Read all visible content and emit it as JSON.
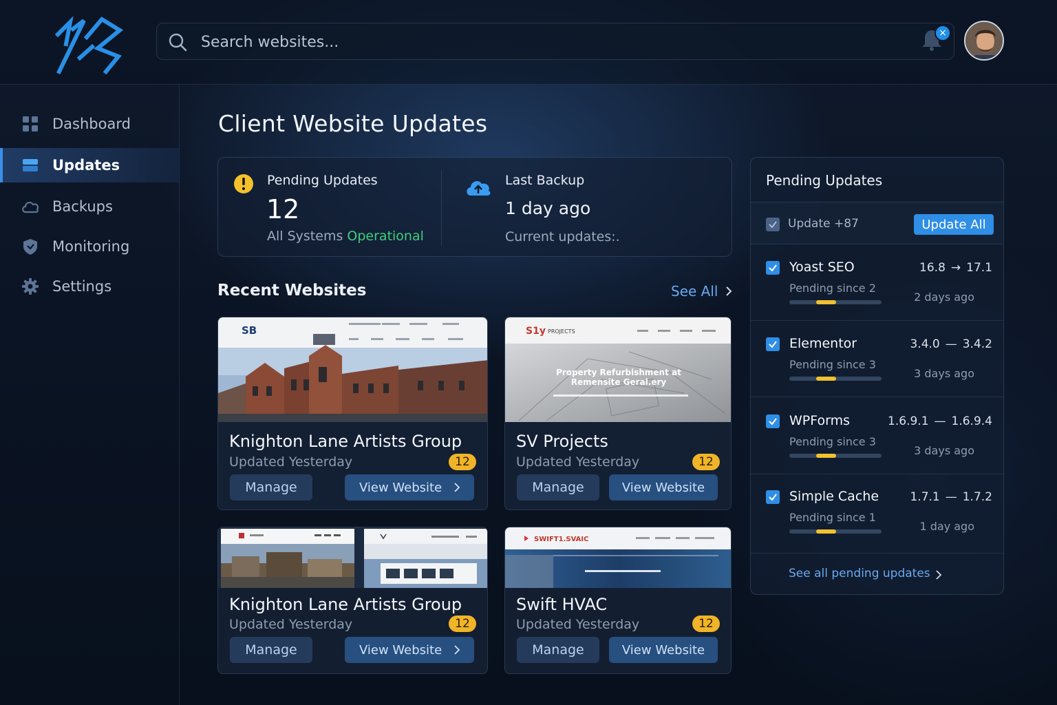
{
  "search": {
    "placeholder": "Search websites..."
  },
  "notifications": {
    "badge": "×"
  },
  "sidebar": {
    "items": [
      {
        "label": "Dashboard",
        "icon": "grid-icon",
        "active": false
      },
      {
        "label": "Updates",
        "icon": "layers-icon",
        "active": true
      },
      {
        "label": "Backups",
        "icon": "cloud-icon",
        "active": false
      },
      {
        "label": "Monitoring",
        "icon": "shield-icon",
        "active": false
      },
      {
        "label": "Settings",
        "icon": "gear-icon",
        "active": false
      }
    ]
  },
  "main": {
    "title": "Client Website Updates",
    "stats": {
      "pending_label": "Pending Updates",
      "pending_count": "12",
      "status_prefix": "All Systems",
      "status_value": "Operational",
      "backup_label": "Last Backup",
      "backup_value": "1 day ago",
      "backup_sub": "Current updates:."
    },
    "recent": {
      "title": "Recent Websites",
      "see_all": "See All",
      "sites": [
        {
          "name": "Knighton Lane Artists Group",
          "updated": "Updated Yesterday",
          "count": "12",
          "manage": "Manage",
          "view": "View Website",
          "thumb_brand": "SB"
        },
        {
          "name": "SV Projects",
          "updated": "Updated Yesterday",
          "count": "12",
          "manage": "Manage",
          "view": "View Website",
          "thumb_brand": "S1y",
          "thumb_nav": "PROJECTS",
          "thumb_headline_1": "Property Refurbishment at",
          "thumb_headline_2": "Remensite Geral.ery"
        },
        {
          "name": "Knighton Lane Artists Group",
          "updated": "Updated Yesterday",
          "count": "12",
          "manage": "Manage",
          "view": "View Website"
        },
        {
          "name": "Swift HVAC",
          "updated": "Updated Yesterday",
          "count": "12",
          "manage": "Manage",
          "view": "View Website",
          "thumb_brand": "SWIFT1.SVAIC"
        }
      ]
    }
  },
  "panel": {
    "title": "Pending Updates",
    "select_label": "Update +87",
    "update_all": "Update All",
    "updates": [
      {
        "name": "Yoast SEO",
        "since": "Pending since 2",
        "from": "16.8",
        "arrow": "→",
        "to": "17.1",
        "ago": "2 days ago",
        "progress": 0.22
      },
      {
        "name": "Elementor",
        "since": "Pending since 3",
        "from": "3.4.0",
        "arrow": "—",
        "to": "3.4.2",
        "ago": "3 days ago",
        "progress": 0.22
      },
      {
        "name": "WPForms",
        "since": "Pending since 3",
        "from": "1.6.9.1",
        "arrow": "—",
        "to": "1.6.9.4",
        "ago": "3 days ago",
        "progress": 0.22
      },
      {
        "name": "Simple Cache",
        "since": "Pending since 1",
        "from": "1.7.1",
        "arrow": "—",
        "to": "1.7.2",
        "ago": "1 day ago",
        "progress": 0.22
      }
    ],
    "footer_link": "See all pending updates"
  },
  "colors": {
    "accent": "#2f8ee6",
    "badge": "#f0b428",
    "success": "#3ecf7a",
    "progress": "#f0c230"
  }
}
